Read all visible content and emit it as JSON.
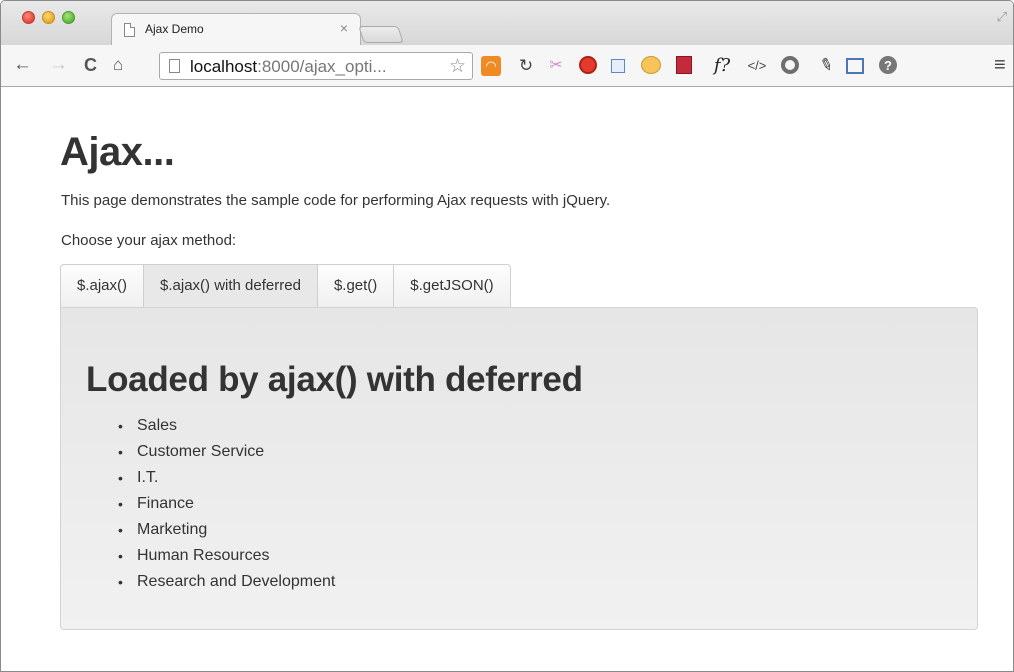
{
  "browser": {
    "tab": {
      "title": "Ajax Demo",
      "close": "×"
    },
    "url": {
      "host": "localhost",
      "rest": ":8000/ajax_opti..."
    }
  },
  "page": {
    "title": "Ajax...",
    "intro": "This page demonstrates the sample code for performing Ajax requests with jQuery.",
    "choose_label": "Choose your ajax method:",
    "tabs": [
      {
        "label": "$.ajax()",
        "active": false
      },
      {
        "label": "$.ajax() with deferred",
        "active": true
      },
      {
        "label": "$.get()",
        "active": false
      },
      {
        "label": "$.getJSON()",
        "active": false
      }
    ],
    "panel": {
      "heading": "Loaded by ajax() with deferred",
      "items": [
        "Sales",
        "Customer Service",
        "I.T.",
        "Finance",
        "Marketing",
        "Human Resources",
        "Research and Development"
      ]
    }
  },
  "icons": {
    "back": "back-arrow-icon",
    "forward": "forward-arrow-icon",
    "reload": "reload-icon",
    "home": "home-icon",
    "bookmark": "star-icon",
    "menu": "menu-icon"
  }
}
